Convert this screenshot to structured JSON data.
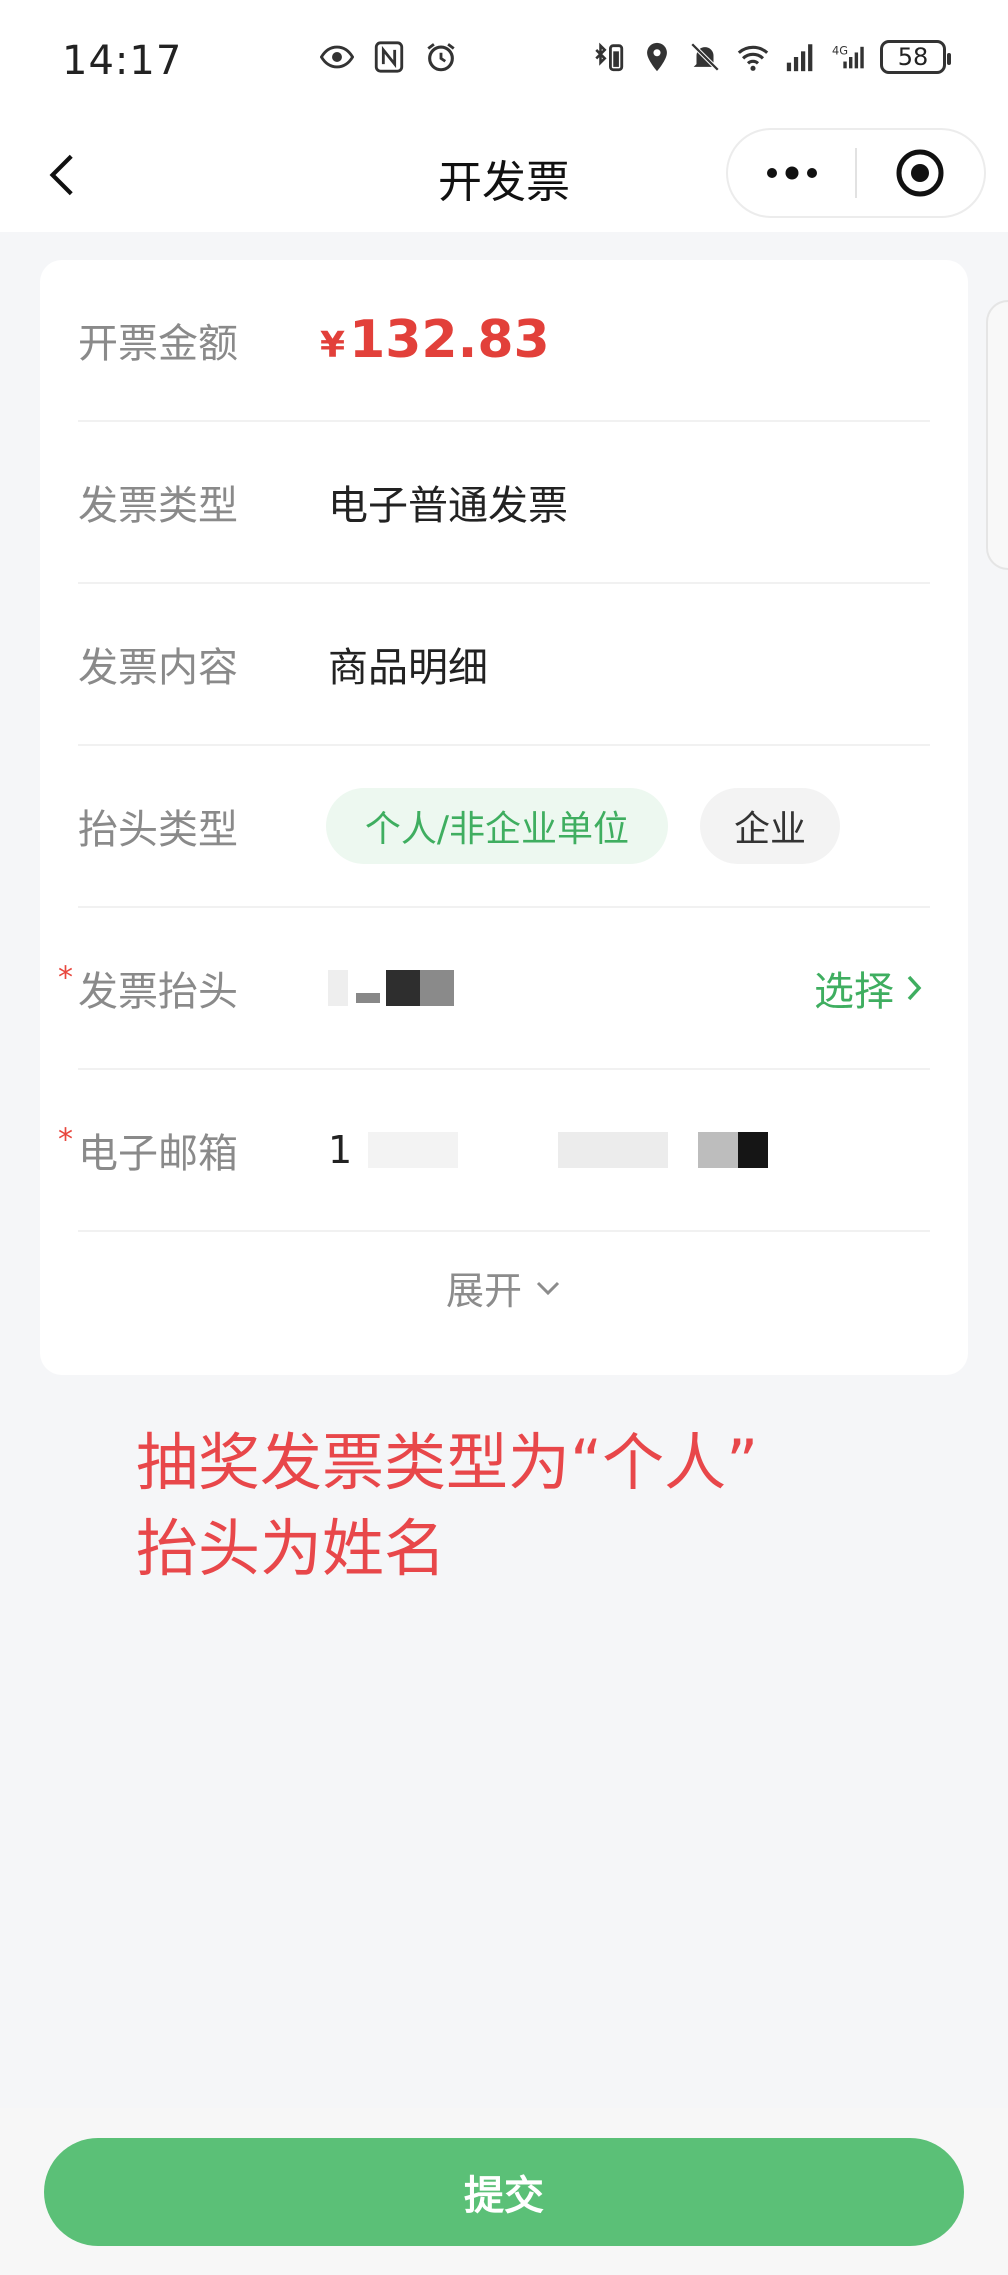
{
  "status_bar": {
    "time": "14:17",
    "battery": "58",
    "network": "4G"
  },
  "nav": {
    "title": "开发票"
  },
  "form": {
    "amount": {
      "label": "开票金额",
      "currency": "¥",
      "value": "132.83"
    },
    "invoice_type": {
      "label": "发票类型",
      "value": "电子普通发票"
    },
    "invoice_content": {
      "label": "发票内容",
      "value": "商品明细"
    },
    "title_type": {
      "label": "抬头类型",
      "options": [
        "个人/非企业单位",
        "企业"
      ],
      "selected": "个人/非企业单位"
    },
    "invoice_title": {
      "label": "发票抬头",
      "required_mark": "*",
      "select_label": "选择"
    },
    "email": {
      "label": "电子邮箱",
      "required_mark": "*",
      "value_partial": "1"
    },
    "expand_label": "展开"
  },
  "annotation": {
    "line1": "抽奖发票类型为“个人”",
    "line2": "抬头为姓名"
  },
  "submit_label": "提交",
  "colors": {
    "accent_green": "#5bc077",
    "amount_red": "#e2403a",
    "annotation_red": "#e8474a"
  }
}
